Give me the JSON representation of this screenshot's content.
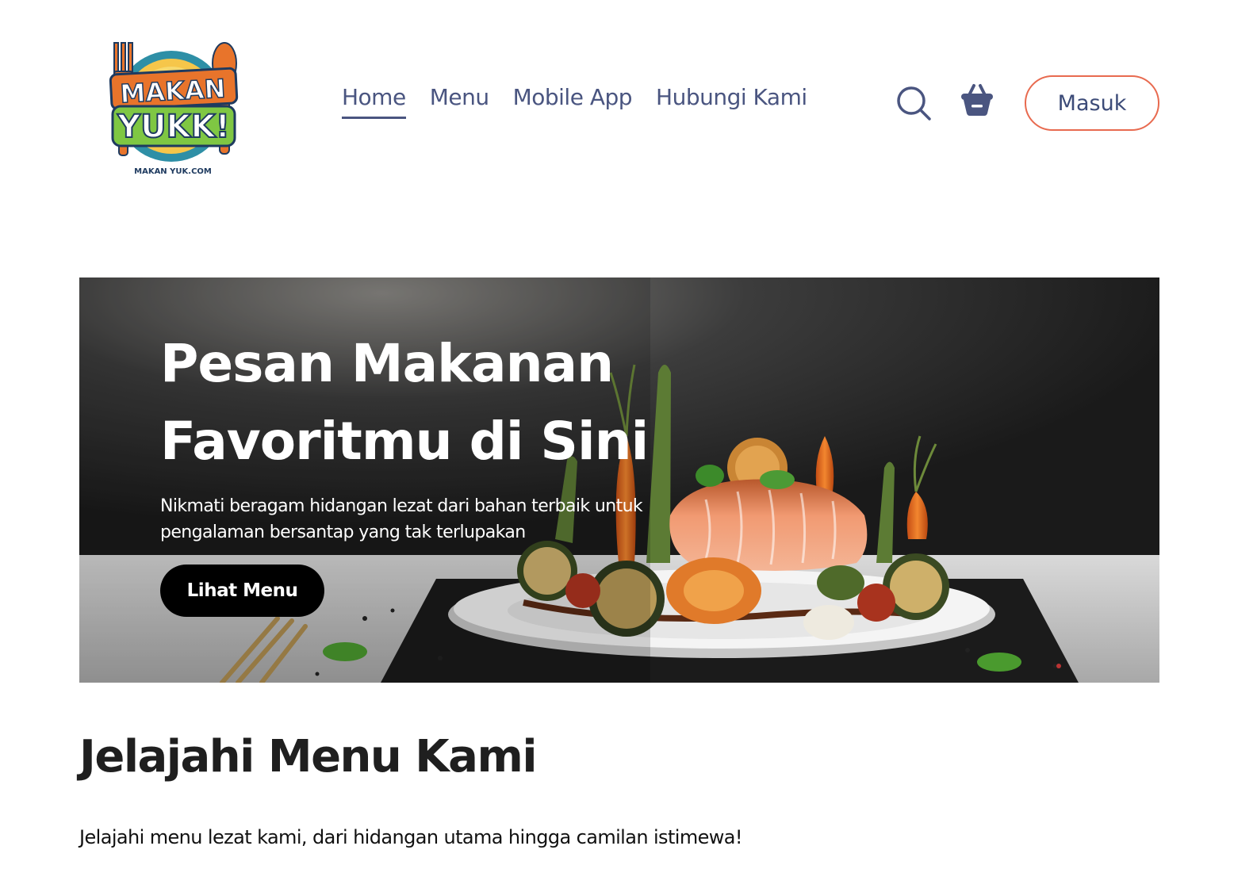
{
  "logo": {
    "brand_line1": "MAKAN",
    "brand_line2": "YUKK!",
    "tagline": "MAKAN YUK.COM"
  },
  "nav": {
    "items": [
      {
        "label": "Home",
        "active": true
      },
      {
        "label": "Menu",
        "active": false
      },
      {
        "label": "Mobile App",
        "active": false
      },
      {
        "label": "Hubungi Kami",
        "active": false
      }
    ]
  },
  "header": {
    "search_icon": "search-icon",
    "cart_icon": "basket-icon",
    "login_label": "Masuk"
  },
  "hero": {
    "title": "Pesan Makanan Favoritmu di Sini",
    "subtitle": "Nikmati beragam hidangan lezat dari bahan terbaik untuk pengalaman bersantap yang tak terlupakan",
    "cta_label": "Lihat Menu"
  },
  "section": {
    "title": "Jelajahi Menu Kami",
    "description": "Jelajahi menu lezat kami, dari hidangan utama hingga camilan istimewa!"
  },
  "colors": {
    "nav_text": "#4a5580",
    "login_border": "#e86a4f",
    "cta_bg": "#000000"
  }
}
